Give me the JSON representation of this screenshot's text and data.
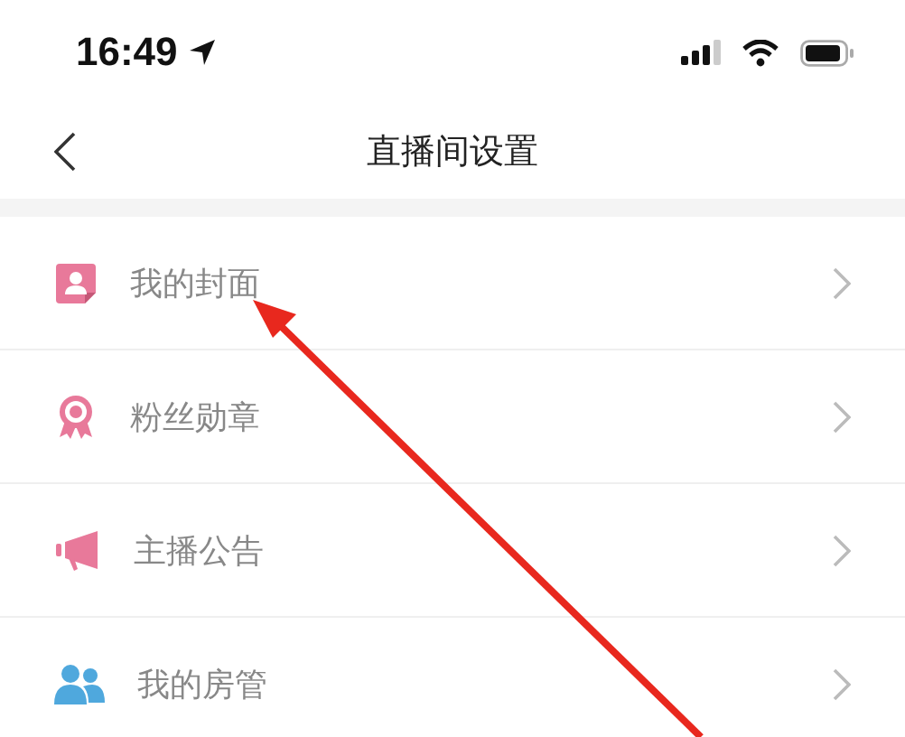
{
  "status_bar": {
    "time": "16:49"
  },
  "nav_bar": {
    "title": "直播间设置"
  },
  "settings": [
    {
      "kind": "cover",
      "label": "我的封面"
    },
    {
      "kind": "medal",
      "label": "粉丝勋章"
    },
    {
      "kind": "announcement",
      "label": "主播公告"
    },
    {
      "kind": "admins",
      "label": "我的房管"
    }
  ],
  "annotations": [
    {
      "kind": "arrow"
    }
  ]
}
